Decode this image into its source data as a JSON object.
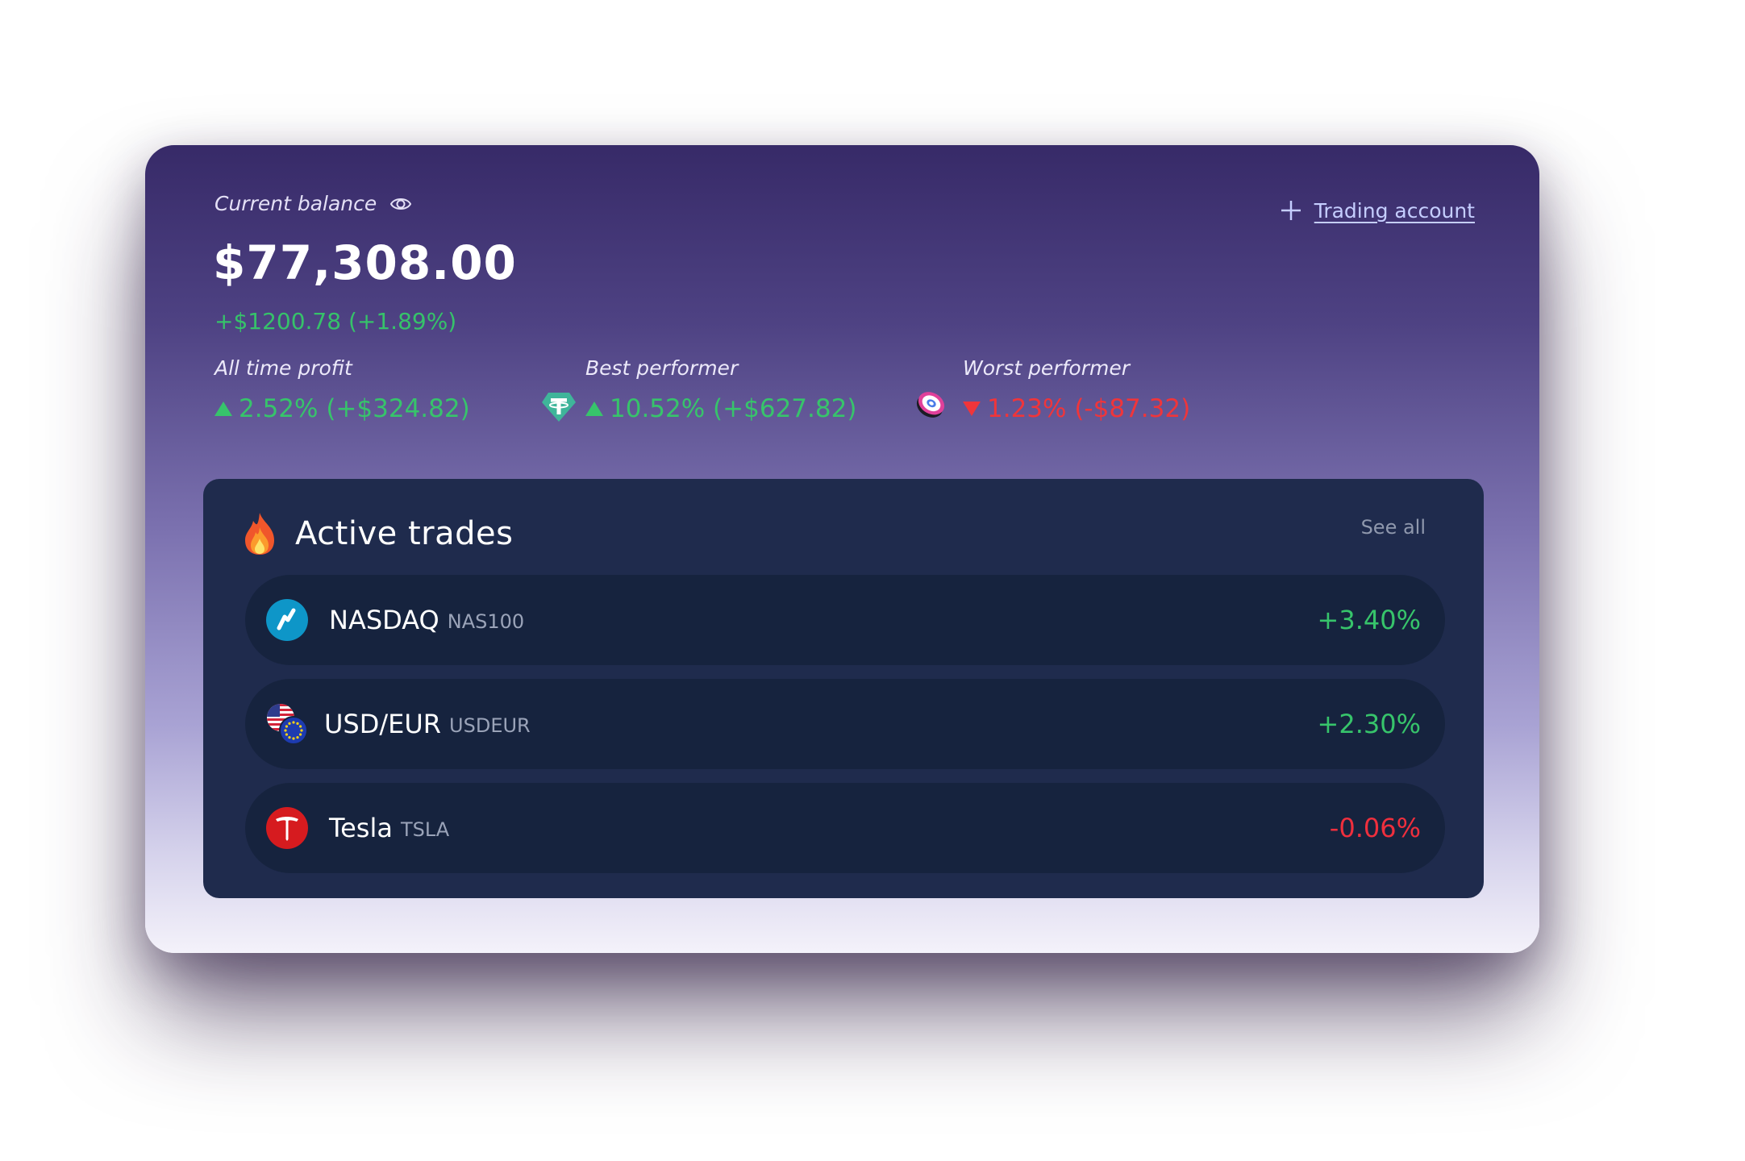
{
  "header": {
    "balance_label": "Current balance",
    "balance_amount": "$77,308.00",
    "balance_change": "+$1200.78 (+1.89%)",
    "eye_icon": "eye-icon",
    "add_account_label": "Trading account",
    "add_icon": "plus-icon"
  },
  "stats": [
    {
      "label": "All time profit",
      "value": "2.52% (+$324.82)",
      "direction": "up"
    },
    {
      "label": "Best performer",
      "value": "10.52% (+$627.82)",
      "direction": "up",
      "icon": "tether-icon"
    },
    {
      "label": "Worst performer",
      "value": "1.23% (-$87.32)",
      "direction": "down",
      "icon": "crypto-coin-icon"
    }
  ],
  "trades": {
    "title": "Active trades",
    "icon": "fire-icon",
    "see_all_label": "See all",
    "items": [
      {
        "name": "NASDAQ",
        "ticker": "NAS100",
        "change": "+3.40%",
        "icon": "nasdaq-icon"
      },
      {
        "name": "USD/EUR",
        "ticker": "USDEUR",
        "change": "+2.30%",
        "icon": "usd-eur-flags-icon"
      },
      {
        "name": "Tesla",
        "ticker": "TSLA",
        "change": "-0.06%",
        "icon": "tesla-icon"
      }
    ]
  },
  "colors": {
    "positive": "#37c46b",
    "negative": "#f0353a",
    "panel": "#1f2b4d",
    "row": "#16233e",
    "link": "#c5ceff"
  }
}
